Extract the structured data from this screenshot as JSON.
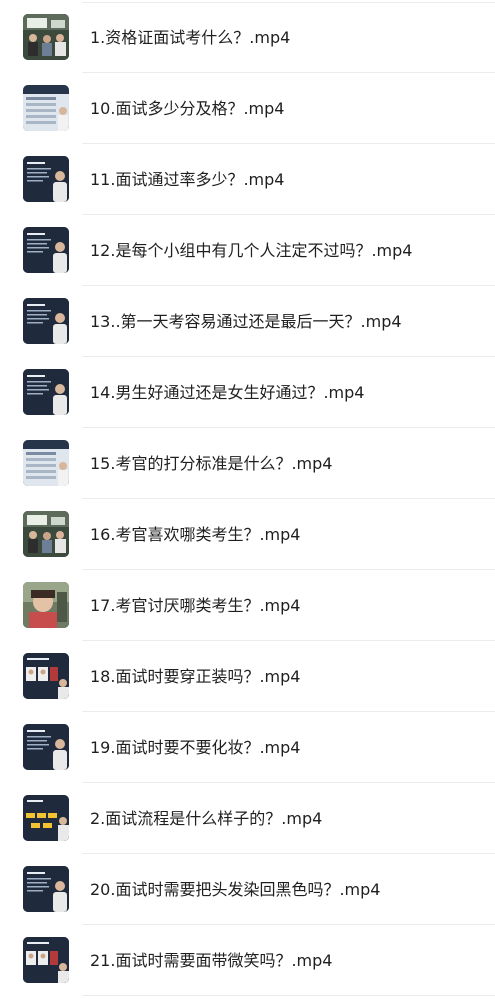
{
  "files": [
    {
      "name": "1.资格证面试考什么？.mp4",
      "thumb": "class-photo"
    },
    {
      "name": "10.面试多少分及格？.mp4",
      "thumb": "slide-table"
    },
    {
      "name": "11.面试通过率多少？.mp4",
      "thumb": "slide-presenter"
    },
    {
      "name": "12.是每个小组中有几个人注定不过吗？.mp4",
      "thumb": "slide-presenter"
    },
    {
      "name": "13..第一天考容易通过还是最后一天？.mp4",
      "thumb": "slide-presenter"
    },
    {
      "name": "14.男生好通过还是女生好通过？.mp4",
      "thumb": "slide-presenter"
    },
    {
      "name": "15.考官的打分标准是什么？.mp4",
      "thumb": "slide-table"
    },
    {
      "name": "16.考官喜欢哪类考生？.mp4",
      "thumb": "class-photo"
    },
    {
      "name": "17.考官讨厌哪类考生？.mp4",
      "thumb": "portrait-photo"
    },
    {
      "name": "18.面试时要穿正装吗？.mp4",
      "thumb": "slide-photos"
    },
    {
      "name": "19.面试时要不要化妆？.mp4",
      "thumb": "slide-presenter"
    },
    {
      "name": "2.面试流程是什么样子的？.mp4",
      "thumb": "slide-flow"
    },
    {
      "name": "20.面试时需要把头发染回黑色吗？.mp4",
      "thumb": "slide-presenter"
    },
    {
      "name": "21.面试时需要面带微笑吗？.mp4",
      "thumb": "slide-photos"
    }
  ]
}
